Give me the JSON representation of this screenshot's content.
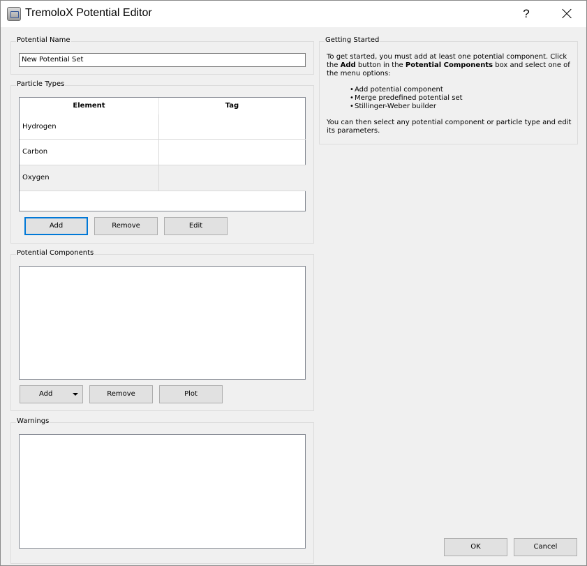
{
  "window": {
    "title": "TremoloX Potential Editor",
    "help_label": "?"
  },
  "potential_name": {
    "group_label": "Potential Name",
    "value": "New Potential Set"
  },
  "particle_types": {
    "group_label": "Particle Types",
    "columns": [
      "Element",
      "Tag"
    ],
    "rows": [
      {
        "element": "Hydrogen",
        "tag": ""
      },
      {
        "element": "Carbon",
        "tag": ""
      },
      {
        "element": "Oxygen",
        "tag": ""
      }
    ],
    "buttons": {
      "add": "Add",
      "remove": "Remove",
      "edit": "Edit"
    }
  },
  "potential_components": {
    "group_label": "Potential Components",
    "buttons": {
      "add": "Add",
      "remove": "Remove",
      "plot": "Plot"
    }
  },
  "warnings": {
    "group_label": "Warnings"
  },
  "getting_started": {
    "group_label": "Getting Started",
    "intro_1": "To get started, you must add at least one potential component. Click the ",
    "intro_bold_1": "Add",
    "intro_2": " button in the ",
    "intro_bold_2": "Potential Components",
    "intro_3": " box and select one of the menu options:",
    "bullets": [
      "Add potential component",
      "Merge predefined potential set",
      "Stillinger-Weber builder"
    ],
    "outro": "You can then select any potential component or particle type and edit its parameters."
  },
  "footer": {
    "ok": "OK",
    "cancel": "Cancel"
  },
  "colors": {
    "dialog_bg": "#f0f0f0",
    "default_button_border": "#0078d7",
    "selected_row_bg": "#f0f0f0"
  }
}
